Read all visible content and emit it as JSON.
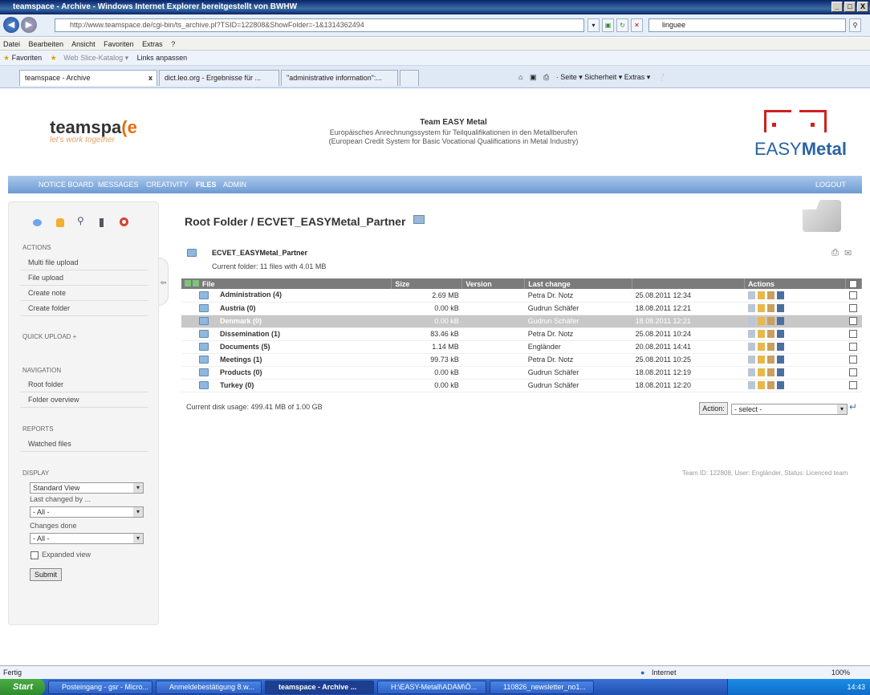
{
  "window": {
    "title": "teamspace - Archive - Windows Internet Explorer bereitgestellt von BWHW",
    "buttons": [
      "_",
      "□",
      "X"
    ]
  },
  "address": {
    "url": "http://www.teamspace.de/cgi-bin/ts_archive.pl?TSID=122808&ShowFolder=-1&1314362494",
    "search": "linguee"
  },
  "menu": [
    "Datei",
    "Bearbeiten",
    "Ansicht",
    "Favoriten",
    "Extras",
    "?"
  ],
  "favorites": {
    "label": "Favoriten",
    "items": [
      "Web Slice-Katalog ▾",
      "Links anpassen"
    ]
  },
  "tabs": [
    {
      "label": "teamspace - Archive",
      "close": "x"
    },
    {
      "label": "dict.leo.org - Ergebnisse für ..."
    },
    {
      "label": "\"administrative information\":..."
    }
  ],
  "toolbar_right": "· Seite ▾  Sicherheit ▾  Extras ▾",
  "header": {
    "logo_text": "teamspa",
    "logo_accent": "(e",
    "slogan": "let's work together",
    "team_title": "Team EASY Metal",
    "team_sub1": "Europäisches Anrechnungssystem für Teilqualifikationen in den Metallberufen",
    "team_sub2": "(European Credit System for Basic Vocational Qualifications in Metal Industry)",
    "easy": "EASY",
    "metal": "Metal"
  },
  "nav": {
    "items": [
      "NOTICE BOARD",
      "MESSAGES",
      "CREATIVITY",
      "FILES",
      "ADMIN"
    ],
    "logout": "LOGOUT"
  },
  "sidebar": {
    "actions_title": "ACTIONS",
    "actions": [
      "Multi file upload",
      "File upload",
      "Create note",
      "Create folder"
    ],
    "quick_upload": "QUICK UPLOAD +",
    "navigation_title": "NAVIGATION",
    "navigation": [
      "Root folder",
      "Folder overview"
    ],
    "reports_title": "REPORTS",
    "reports": [
      "Watched files"
    ],
    "display_title": "DISPLAY",
    "view_select": "Standard View",
    "last_changed_label": "Last changed by ...",
    "last_changed_select": "- All -",
    "changes_label": "Changes done",
    "changes_select": "- All -",
    "expanded_label": "Expanded view",
    "submit": "Submit"
  },
  "main": {
    "heading": "Root Folder / ECVET_EASYMetal_Partner",
    "folder_name": "ECVET_EASYMetal_Partner",
    "folder_info": "Current folder: 11 files with 4.01 MB",
    "columns": [
      "File",
      "Size",
      "Version",
      "Last change",
      "",
      "Actions"
    ],
    "rows": [
      {
        "name": "Administration (4)",
        "size": "2.69 MB",
        "user": "Petra Dr. Notz",
        "date": "25.08.2011 12:34"
      },
      {
        "name": "Austria (0)",
        "size": "0.00 kB",
        "user": "Gudrun Schäfer",
        "date": "18.08.2011 12:21"
      },
      {
        "name": "Denmark (0)",
        "size": "0.00 kB",
        "user": "Gudrun Schäfer",
        "date": "18.08.2011 12:21"
      },
      {
        "name": "Dissemination (1)",
        "size": "83.46 kB",
        "user": "Petra Dr. Notz",
        "date": "25.08.2011 10:24"
      },
      {
        "name": "Documents (5)",
        "size": "1.14 MB",
        "user": "Engländer",
        "date": "20.08.2011 14:41"
      },
      {
        "name": "Meetings (1)",
        "size": "99.73 kB",
        "user": "Petra Dr. Notz",
        "date": "25.08.2011 10:25"
      },
      {
        "name": "Products (0)",
        "size": "0.00 kB",
        "user": "Gudrun Schäfer",
        "date": "18.08.2011 12:19"
      },
      {
        "name": "Turkey (0)",
        "size": "0.00 kB",
        "user": "Gudrun Schäfer",
        "date": "18.08.2011 12:20"
      }
    ],
    "selected_row": 2,
    "disk_usage": "Current disk usage: 499.41 MB of 1.00 GB",
    "action_label": "Action:",
    "action_select": "- select -",
    "team_info": "Team ID: 122808, User: Engländer, Status: Licenced team"
  },
  "statusbar": {
    "left": "Fertig",
    "zone": "Internet",
    "zoom": "100%"
  },
  "taskbar": {
    "start": "Start",
    "tasks": [
      "Posteingang - gsr - Micro...",
      "Anmeldebestätigung 8.w...",
      "teamspace - Archive ...",
      "H:\\EASY-Metall\\ADAM\\Ö...",
      "110826_newsletter_no1..."
    ],
    "active_task": 2,
    "clock": "14:43"
  }
}
